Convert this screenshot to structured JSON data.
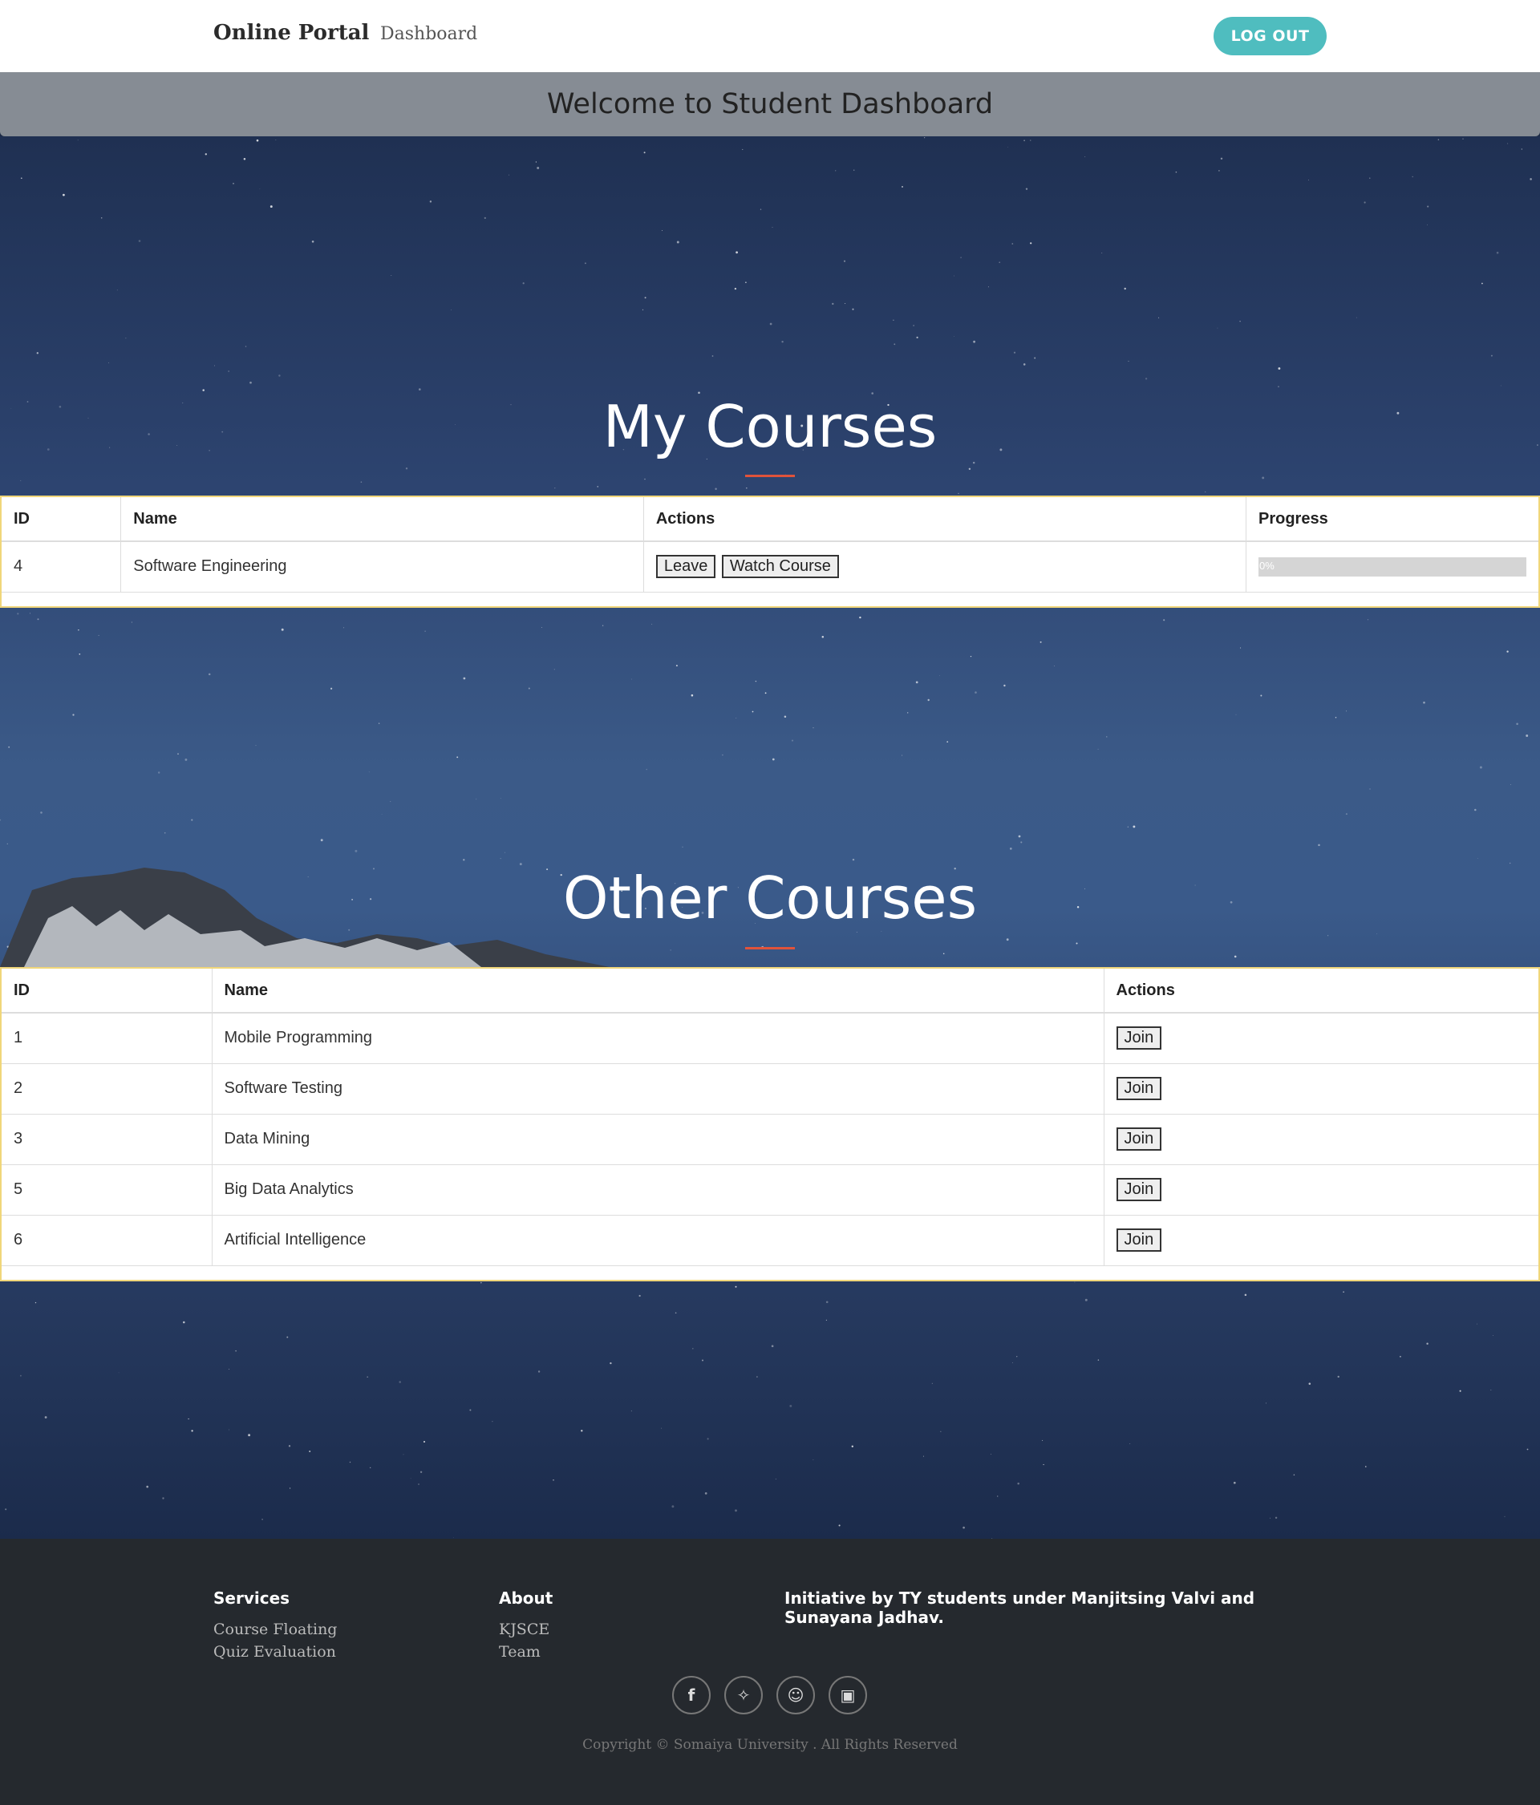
{
  "nav": {
    "brand": "Online Portal",
    "dashboard": "Dashboard",
    "logout": "LOG OUT"
  },
  "banner": {
    "welcome": "Welcome to Student Dashboard"
  },
  "my_courses": {
    "title": "My Courses",
    "headers": [
      "ID",
      "Name",
      "Actions",
      "Progress"
    ],
    "rows": [
      {
        "id": "4",
        "name": "Software Engineering",
        "leave": "Leave",
        "watch": "Watch Course",
        "progress_label": "0%",
        "progress": 0
      }
    ]
  },
  "other_courses": {
    "title": "Other Courses",
    "headers": [
      "ID",
      "Name",
      "Actions"
    ],
    "rows": [
      {
        "id": "1",
        "name": "Mobile Programming",
        "action": "Join"
      },
      {
        "id": "2",
        "name": "Software Testing",
        "action": "Join"
      },
      {
        "id": "3",
        "name": "Data Mining",
        "action": "Join"
      },
      {
        "id": "5",
        "name": "Big Data Analytics",
        "action": "Join"
      },
      {
        "id": "6",
        "name": "Artificial Intelligence",
        "action": "Join"
      }
    ]
  },
  "footer": {
    "services_title": "Services",
    "services": [
      "Course Floating",
      "Quiz Evaluation"
    ],
    "about_title": "About",
    "about": [
      "KJSCE",
      "Team"
    ],
    "initiative": "Initiative by TY students under Manjitsing Valvi and Sunayana Jadhav.",
    "social": [
      {
        "icon": "facebook-icon",
        "glyph": "f"
      },
      {
        "icon": "twitter-icon",
        "glyph": "✧"
      },
      {
        "icon": "snapchat-icon",
        "glyph": "☺"
      },
      {
        "icon": "instagram-icon",
        "glyph": "▣"
      }
    ],
    "copyright": "Copyright © Somaiya University . All Rights Reserved"
  },
  "colors": {
    "accent": "#4fbdbf",
    "underline": "#e0533b",
    "footer_bg": "#25292e"
  }
}
